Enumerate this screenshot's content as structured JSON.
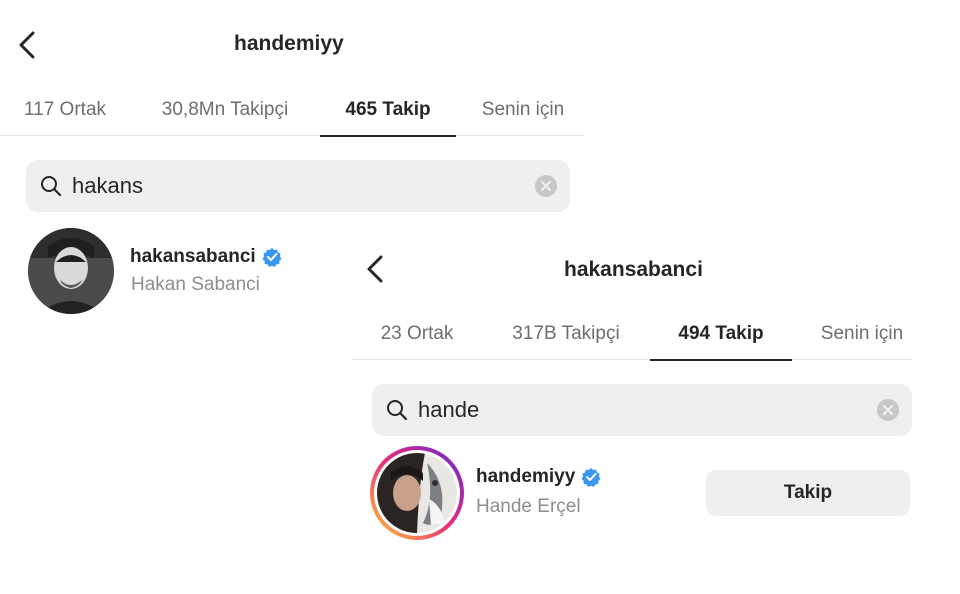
{
  "screen_a": {
    "header": {
      "title": "handemiyy"
    },
    "tabs": [
      {
        "label": "117 Ortak"
      },
      {
        "label": "30,8Mn Takipçi"
      },
      {
        "label": "465 Takip",
        "active": true
      },
      {
        "label": "Senin için"
      }
    ],
    "search": {
      "value": "hakans"
    },
    "results": [
      {
        "username": "hakansabanci",
        "full_name": "Hakan Sabanci",
        "verified": true
      }
    ]
  },
  "screen_b": {
    "header": {
      "title": "hakansabanci"
    },
    "tabs": [
      {
        "label": "23 Ortak"
      },
      {
        "label": "317B Takipçi"
      },
      {
        "label": "494 Takip",
        "active": true
      },
      {
        "label": "Senin için"
      }
    ],
    "search": {
      "value": "hande"
    },
    "results": [
      {
        "username": "handemiyy",
        "full_name": "Hande Erçel",
        "verified": true,
        "action_label": "Takip"
      }
    ]
  },
  "colors": {
    "text_primary": "#262626",
    "text_secondary": "#8e8e8e",
    "verified_blue": "#3897f0",
    "search_bg": "#efefef",
    "story_ring_start": "#f9ce34",
    "story_ring_end": "#ee2a7b"
  },
  "icons": {
    "back": "chevron-left-icon",
    "search": "search-icon",
    "clear": "clear-circle-icon",
    "verified": "verified-badge-icon"
  }
}
